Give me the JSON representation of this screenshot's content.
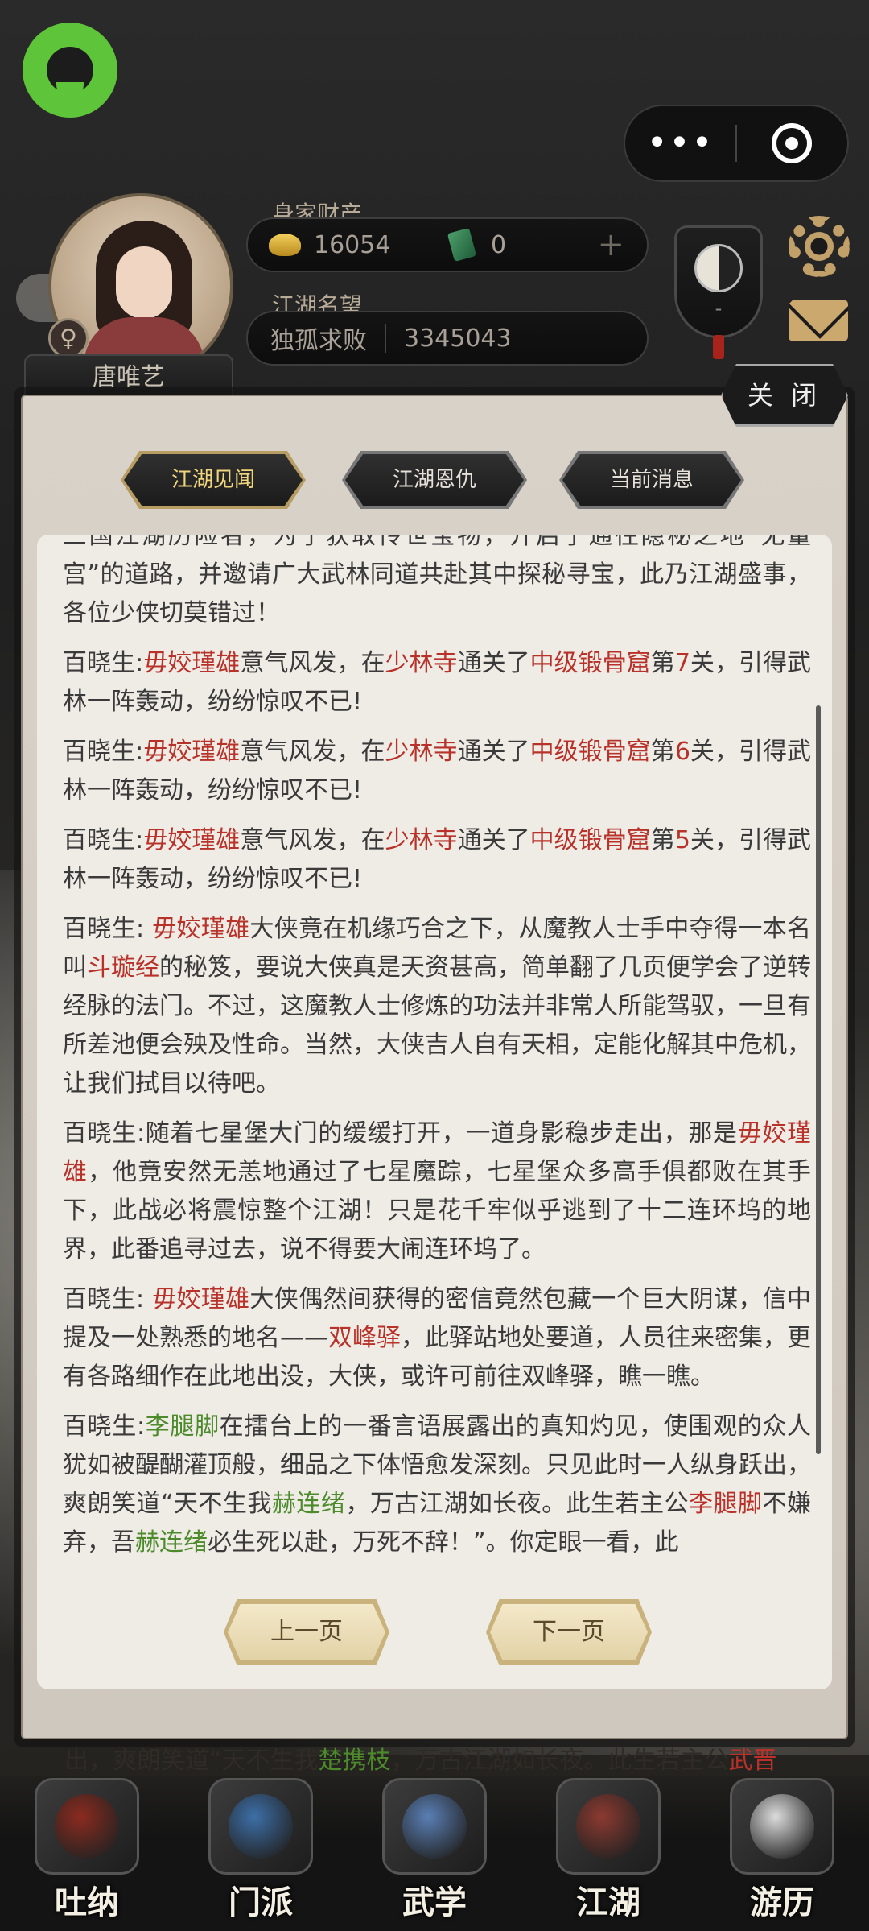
{
  "profile": {
    "name": "唐唯艺",
    "gender_symbol": "♀",
    "wealth_label": "身家财产",
    "gold": "16054",
    "jade": "0",
    "plus": "+",
    "reputation_label": "江湖名望",
    "reputation_title": "独孤求败",
    "reputation_value": "3345043",
    "badge_minus": "-"
  },
  "capsule": {
    "more": "•••"
  },
  "dialog": {
    "close_label": "关 闭",
    "tabs": [
      "江湖见闻",
      "江湖恩仇",
      "当前消息"
    ],
    "active_tab": 0,
    "prev_label": "上一页",
    "next_label": "下一页"
  },
  "messages": [
    [
      {
        "t": "三国江湖历险者，为了获取传世宝物，开启了通往隐秘之地“无量宫”的道路，并邀请广大武林同道共赴其中探秘寻宝，此乃江湖盛事，各位少侠切莫错过！",
        "c": ""
      }
    ],
    [
      {
        "t": "百晓生:",
        "c": ""
      },
      {
        "t": "毋姣瑾雄",
        "c": "red"
      },
      {
        "t": "意气风发，在",
        "c": ""
      },
      {
        "t": "少林寺",
        "c": "red"
      },
      {
        "t": "通关了",
        "c": ""
      },
      {
        "t": "中级锻骨窟",
        "c": "red"
      },
      {
        "t": "第",
        "c": ""
      },
      {
        "t": "7",
        "c": "red"
      },
      {
        "t": "关，引得武林一阵轰动，纷纷惊叹不已!",
        "c": ""
      }
    ],
    [
      {
        "t": "百晓生:",
        "c": ""
      },
      {
        "t": "毋姣瑾雄",
        "c": "red"
      },
      {
        "t": "意气风发，在",
        "c": ""
      },
      {
        "t": "少林寺",
        "c": "red"
      },
      {
        "t": "通关了",
        "c": ""
      },
      {
        "t": "中级锻骨窟",
        "c": "red"
      },
      {
        "t": "第",
        "c": ""
      },
      {
        "t": "6",
        "c": "red"
      },
      {
        "t": "关，引得武林一阵轰动，纷纷惊叹不已!",
        "c": ""
      }
    ],
    [
      {
        "t": "百晓生:",
        "c": ""
      },
      {
        "t": "毋姣瑾雄",
        "c": "red"
      },
      {
        "t": "意气风发，在",
        "c": ""
      },
      {
        "t": "少林寺",
        "c": "red"
      },
      {
        "t": "通关了",
        "c": ""
      },
      {
        "t": "中级锻骨窟",
        "c": "red"
      },
      {
        "t": "第",
        "c": ""
      },
      {
        "t": "5",
        "c": "red"
      },
      {
        "t": "关，引得武林一阵轰动，纷纷惊叹不已!",
        "c": ""
      }
    ],
    [
      {
        "t": "百晓生: ",
        "c": ""
      },
      {
        "t": "毋姣瑾雄",
        "c": "red"
      },
      {
        "t": "大侠竟在机缘巧合之下，从魔教人士手中夺得一本名叫",
        "c": ""
      },
      {
        "t": "斗璇经",
        "c": "red"
      },
      {
        "t": "的秘笈，要说大侠真是天资甚高，简单翻了几页便学会了逆转经脉的法门。不过，这魔教人士修炼的功法并非常人所能驾驭，一旦有所差池便会殃及性命。当然，大侠吉人自有天相，定能化解其中危机，让我们拭目以待吧。",
        "c": ""
      }
    ],
    [
      {
        "t": "百晓生:随着七星堡大门的缓缓打开，一道身影稳步走出，那是",
        "c": ""
      },
      {
        "t": "毋姣瑾雄",
        "c": "red"
      },
      {
        "t": "，他竟安然无恙地通过了七星魔踪，七星堡众多高手俱都败在其手下，此战必将震惊整个江湖！只是花千牢似乎逃到了十二连环坞的地界，此番追寻过去，说不得要大闹连环坞了。",
        "c": ""
      }
    ],
    [
      {
        "t": "百晓生: ",
        "c": ""
      },
      {
        "t": "毋姣瑾雄",
        "c": "red"
      },
      {
        "t": "大侠偶然间获得的密信竟然包藏一个巨大阴谋，信中提及一处熟悉的地名——",
        "c": ""
      },
      {
        "t": "双峰驿",
        "c": "red"
      },
      {
        "t": "，此驿站地处要道，人员往来密集，更有各路细作在此地出没，大侠，或许可前往双峰驿，瞧一瞧。",
        "c": ""
      }
    ],
    [
      {
        "t": "百晓生:",
        "c": ""
      },
      {
        "t": "李腿脚",
        "c": "green"
      },
      {
        "t": "在擂台上的一番言语展露出的真知灼见，使围观的众人犹如被醍醐灌顶般，细品之下体悟愈发深刻。只见此时一人纵身跃出，爽朗笑道“天不生我",
        "c": ""
      },
      {
        "t": "赫连绪",
        "c": "green"
      },
      {
        "t": "，万古江湖如长夜。此生若主公",
        "c": ""
      },
      {
        "t": "李腿脚",
        "c": "red"
      },
      {
        "t": "不嫌弃，吾",
        "c": ""
      },
      {
        "t": "赫连绪",
        "c": "green"
      },
      {
        "t": "必生死以赴，万死不辞！”。你定眼一看，此",
        "c": ""
      }
    ]
  ],
  "ticker": [
    {
      "t": "出，爽朗笑道“天不生我",
      "c": ""
    },
    {
      "t": "楚携枝",
      "c": "green"
    },
    {
      "t": "，万古江湖如长夜。此生若主公",
      "c": ""
    },
    {
      "t": "武晋",
      "c": "red"
    }
  ],
  "nav": [
    {
      "label": "吐纳",
      "icon": "gourd-icon",
      "color": "#8b2b1f"
    },
    {
      "label": "门派",
      "icon": "sect-flag-icon",
      "color": "#3d6fa8"
    },
    {
      "label": "武学",
      "icon": "book-icon",
      "color": "#5a7fb5"
    },
    {
      "label": "江湖",
      "icon": "hat-icon",
      "color": "#8c3a30"
    },
    {
      "label": "游历",
      "icon": "horse-icon",
      "color": "#dcdcdc"
    }
  ],
  "colors": {
    "highlight_red": "#b8322a",
    "highlight_green": "#4d8a2c",
    "active_tab": "#f0d57d"
  }
}
